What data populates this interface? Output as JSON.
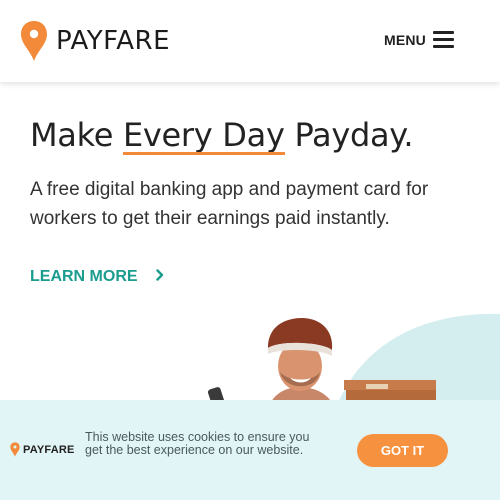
{
  "header": {
    "brand": "PAYFARE",
    "menu_label": "MENU"
  },
  "hero": {
    "title_before": "Make ",
    "title_highlight": "Every Day",
    "title_after": " Payday.",
    "subtitle": "A free digital banking app and payment card for workers to get their earnings paid instantly.",
    "cta_label": "LEARN MORE"
  },
  "cookie_banner": {
    "brand": "PAYFARE",
    "message": "This website uses cookies to ensure you get the best experience on our website.",
    "button_label": "GOT IT"
  },
  "colors": {
    "accent_orange": "#f28a3a",
    "teal_link": "#1a9c8f",
    "banner_bg": "#e1f4f6",
    "button_orange": "#f6923f"
  },
  "icons": {
    "logo": "location-pin-icon",
    "menu": "hamburger-icon",
    "cta": "chevron-right-icon"
  }
}
